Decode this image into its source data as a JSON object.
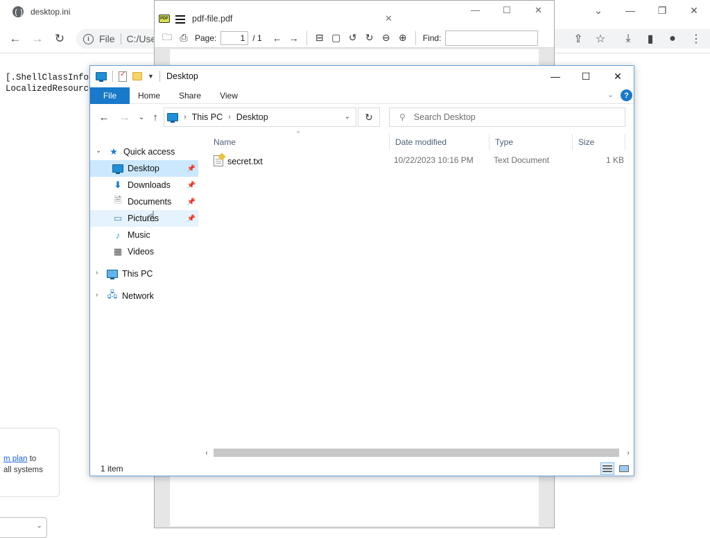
{
  "browser": {
    "tab_title": "desktop.ini",
    "omnibox_scheme": "File",
    "omnibox_path": "C:/User",
    "content_lines": [
      "[.ShellClassInfo]",
      "LocalizedResource"
    ],
    "promo_link": "m plan",
    "promo_text_1": " to",
    "promo_text_2": "all systems"
  },
  "pdf": {
    "title": "pdf-file.pdf",
    "page_label": "Page:",
    "page_value": "1",
    "page_total": "/ 1",
    "find_label": "Find:",
    "logo_text": "PDF"
  },
  "explorer": {
    "title": "Desktop",
    "ribbon_tabs": [
      "File",
      "Home",
      "Share",
      "View"
    ],
    "help": "?",
    "address": {
      "crumbs": [
        "This PC",
        "Desktop"
      ]
    },
    "search_placeholder": "Search Desktop",
    "nav": {
      "quick_access": "Quick access",
      "items": [
        {
          "label": "Desktop",
          "icon": "desktop-icon",
          "pinned": true
        },
        {
          "label": "Downloads",
          "icon": "downloads-icon",
          "pinned": true
        },
        {
          "label": "Documents",
          "icon": "documents-icon",
          "pinned": true
        },
        {
          "label": "Pictures",
          "icon": "pictures-icon",
          "pinned": true
        },
        {
          "label": "Music",
          "icon": "music-icon",
          "pinned": false
        },
        {
          "label": "Videos",
          "icon": "videos-icon",
          "pinned": false
        }
      ],
      "this_pc": "This PC",
      "network": "Network"
    },
    "columns": [
      "Name",
      "Date modified",
      "Type",
      "Size"
    ],
    "files": [
      {
        "name": "secret.txt",
        "modified": "10/22/2023 10:16 PM",
        "type": "Text Document",
        "size": "1 KB"
      }
    ],
    "status": "1 item"
  },
  "colors": {
    "accent": "#1979ca",
    "selection": "#cce8ff",
    "link": "#1a62d6"
  }
}
